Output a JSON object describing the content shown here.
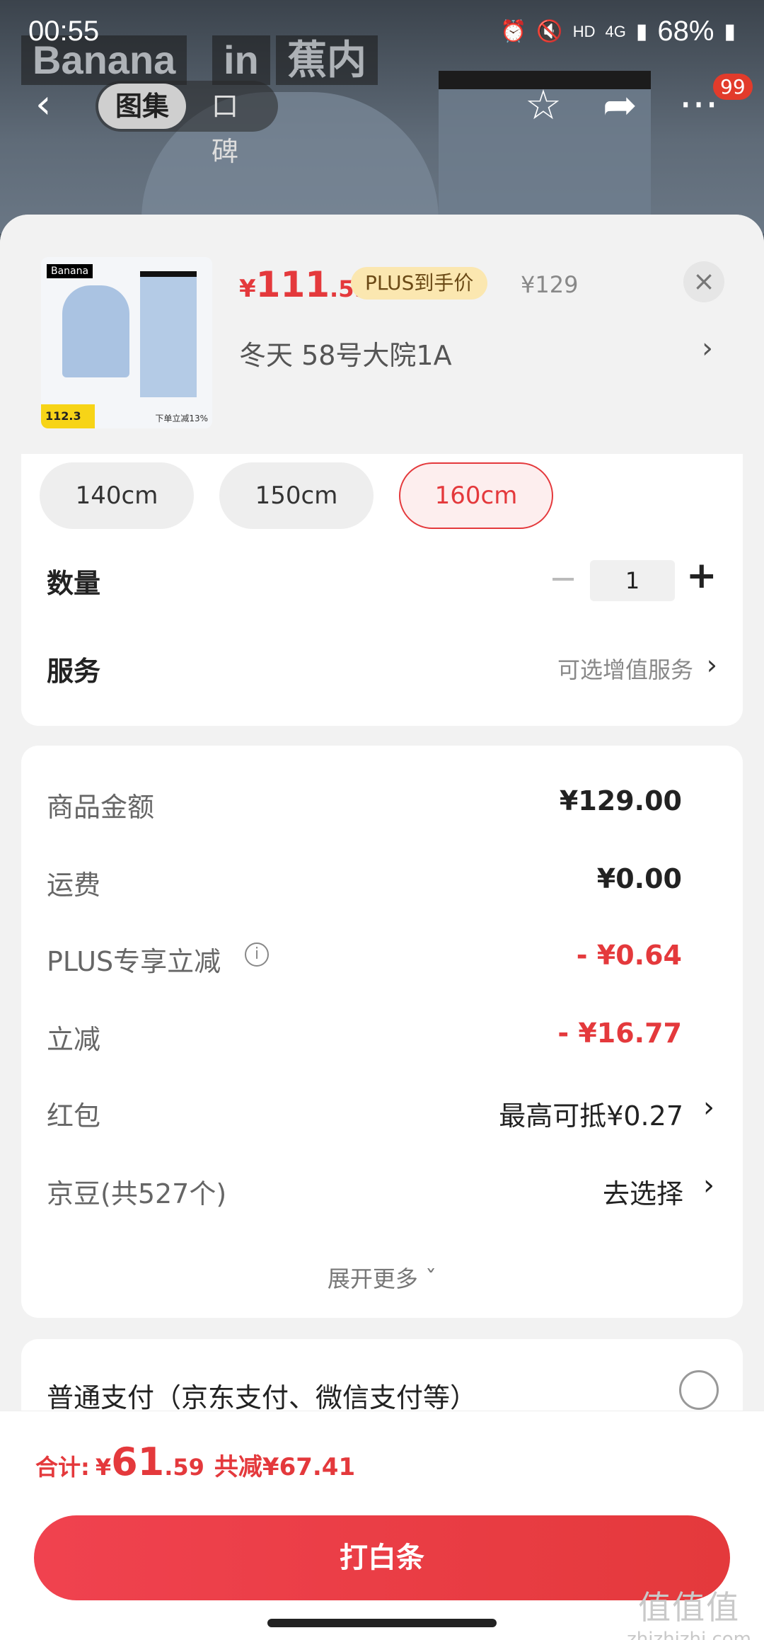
{
  "status_bar": {
    "time": "00:55",
    "network": "4G",
    "hd": "HD",
    "battery": "68%"
  },
  "nav": {
    "tabs": [
      "图集",
      "口碑"
    ],
    "more_badge": "99"
  },
  "brand_banner": {
    "brand": "Banana",
    "in": "in",
    "cn": "蕉内"
  },
  "product": {
    "price_symbol": "¥",
    "price_int": "111",
    "price_dec": ".59",
    "plus_label": "PLUS到手价",
    "original_price": "¥129",
    "spec": "冬天  58号大院1A",
    "thumb_price": "112.3",
    "thumb_note": "下单立减13%"
  },
  "sizes": [
    "140cm",
    "150cm",
    "160cm"
  ],
  "selected_size": "160cm",
  "quantity": {
    "label": "数量",
    "value": "1"
  },
  "service": {
    "label": "服务",
    "value": "可选增值服务"
  },
  "fees": [
    {
      "label": "商品金额",
      "value": "¥129.00",
      "style": "bold"
    },
    {
      "label": "运费",
      "value": "¥0.00",
      "style": "bold"
    },
    {
      "label": "PLUS专享立减",
      "value": "- ¥0.64",
      "style": "red",
      "info": true
    },
    {
      "label": "立减",
      "value": "- ¥16.77",
      "style": "red"
    },
    {
      "label": "红包",
      "value": "最高可抵¥0.27",
      "style": "normal",
      "chevron": true
    },
    {
      "label": "京豆(共527个)",
      "value": "去选择",
      "style": "normal",
      "chevron": true
    }
  ],
  "expand_more": "展开更多",
  "payment": {
    "label": "普通支付（京东支付、微信支付等）"
  },
  "total": {
    "label": "合计:",
    "symbol": "¥",
    "int": "61",
    "dec": ".59",
    "saved": "共减¥67.41"
  },
  "cta": "打白条",
  "watermark": {
    "big": "值值值",
    "small": "zhizhizhi.com"
  },
  "colors": {
    "accent": "#e4393c",
    "plus_bg": "#fbe7b0"
  }
}
